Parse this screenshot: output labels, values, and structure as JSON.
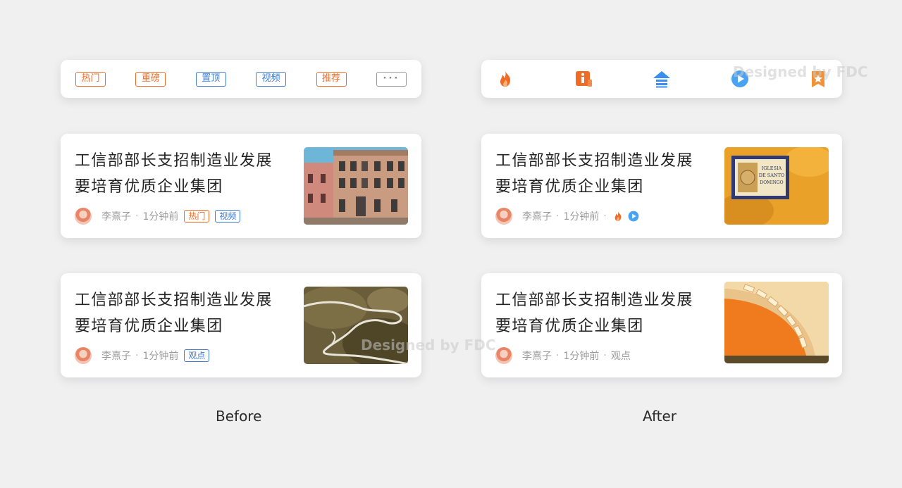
{
  "before": {
    "tags": [
      "热门",
      "重磅",
      "置顶",
      "视频",
      "推荐"
    ],
    "more_label": "···",
    "cards": [
      {
        "title_line1": "工信部部长支招制造业发展",
        "title_line2": "要培育优质企业集团",
        "author": "李熹子",
        "time": "1分钟前",
        "tags": [
          "热门",
          "视频"
        ]
      },
      {
        "title_line1": "工信部部长支招制造业发展",
        "title_line2": "要培育优质企业集团",
        "author": "李熹子",
        "time": "1分钟前",
        "tags": [
          "观点"
        ]
      }
    ],
    "caption": "Before"
  },
  "after": {
    "icons": [
      "fire-icon",
      "info-icon",
      "pin-top-icon",
      "play-icon",
      "bookmark-star-icon"
    ],
    "cards": [
      {
        "title_line1": "工信部部长支招制造业发展",
        "title_line2": "要培育优质企业集团",
        "author": "李熹子",
        "time": "1分钟前",
        "icons": [
          "fire-icon",
          "play-icon"
        ]
      },
      {
        "title_line1": "工信部部长支招制造业发展",
        "title_line2": "要培育优质企业集团",
        "author": "李熹子",
        "time": "1分钟前",
        "label": "观点"
      }
    ],
    "caption": "After"
  },
  "watermark": "Designed by FDC",
  "thumb_sign_text": "IGLESIA DE SANTO DOMINGO",
  "colors": {
    "orange": "#ef6b26",
    "blue": "#3f7bd3",
    "icon_blue": "#3a8ef0",
    "background": "#f0f0f1"
  }
}
